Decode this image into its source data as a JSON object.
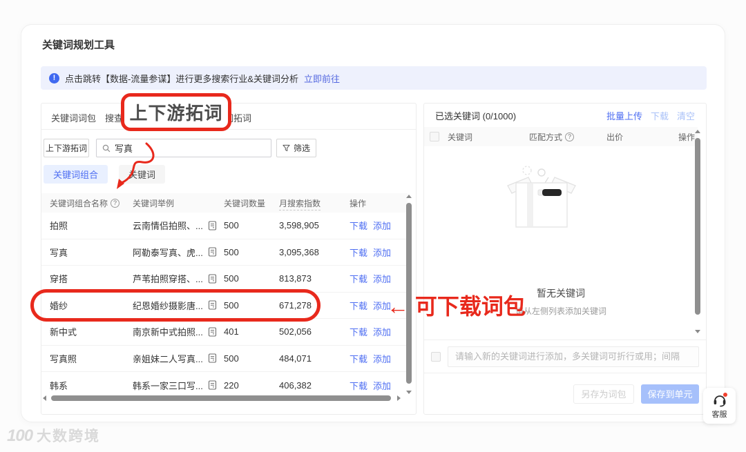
{
  "page": {
    "title": "关键词规划工具"
  },
  "notice": {
    "icon_glyph": "!",
    "text": "点击跳转【数据-流量参谋】进行更多搜索行业&关键词分析",
    "link": "立即前往"
  },
  "icons": {
    "help": "?"
  },
  "left_panel": {
    "tabs": [
      {
        "label": "关键词词包"
      },
      {
        "label": "搜查关键词"
      },
      {
        "label": "上下游拓词"
      },
      {
        "label": "以词拓词"
      }
    ],
    "toolbar": {
      "type_select": "上下游拓词",
      "search_value": "写真",
      "filter_label": "筛选"
    },
    "pills": [
      {
        "label": "关键词组合"
      },
      {
        "label": "关键词"
      }
    ],
    "table": {
      "headers": [
        "关键词组合名称",
        "关键词举例",
        "关键词数量",
        "月搜索指数",
        "操作"
      ],
      "action_download": "下载",
      "action_add": "添加",
      "rows": [
        {
          "name": "拍照",
          "example": "云南情侣拍照、...",
          "count": "500",
          "index": "3,598,905"
        },
        {
          "name": "写真",
          "example": "阿勒泰写真、虎...",
          "count": "500",
          "index": "3,095,368"
        },
        {
          "name": "穿搭",
          "example": "芦苇拍照穿搭、...",
          "count": "500",
          "index": "813,873"
        },
        {
          "name": "婚纱",
          "example": "纪恩婚纱摄影唐...",
          "count": "500",
          "index": "671,278"
        },
        {
          "name": "新中式",
          "example": "南京新中式拍照...",
          "count": "401",
          "index": "502,056"
        },
        {
          "name": "写真照",
          "example": "亲姐妹二人写真...",
          "count": "500",
          "index": "484,071"
        },
        {
          "name": "韩系",
          "example": "韩系一家三口写...",
          "count": "220",
          "index": "406,382"
        }
      ]
    }
  },
  "right_panel": {
    "title": "已选关键词 (0/1000)",
    "actions": {
      "bulk_upload": "批量上传",
      "download": "下载",
      "clear": "清空"
    },
    "table_headers": [
      "关键词",
      "匹配方式",
      "出价",
      "操作"
    ],
    "empty": {
      "title": "暂无关键词",
      "hint": "请从左侧列表添加关键词"
    },
    "input_placeholder": "请输入新的关键词进行添加，多关键词可折行或用；间隔",
    "buttons": {
      "save_as_pack": "另存为词包",
      "save_to_unit": "保存到单元"
    }
  },
  "annotations": {
    "tab_callout": "上下游拓词",
    "row_label": "← 可下载词包"
  },
  "support": {
    "label": "客服"
  },
  "watermark": {
    "logo": "100",
    "text": "大数跨境"
  },
  "colors": {
    "accent_blue": "#4e6ef2",
    "annotation_red": "#e8291c",
    "notice_bg": "#eef1fd"
  }
}
